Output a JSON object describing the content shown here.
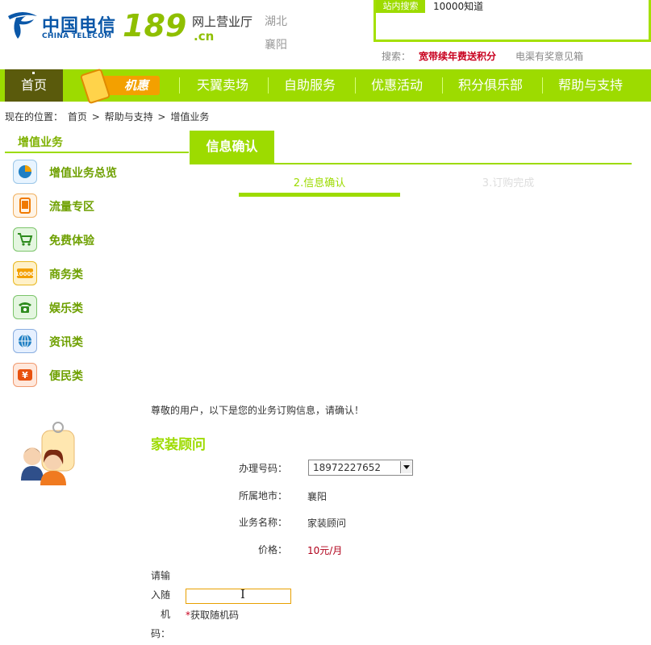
{
  "header": {
    "logo_cn": "中国电信",
    "logo_en": "CHINA TELECOM",
    "brand_number": "189",
    "hall_name": "网上营业厅",
    "domain_suffix": ".cn",
    "province": "湖北",
    "city": "襄阳",
    "search_tab": "站内搜索",
    "search_value": "10000知道",
    "search_label": "搜索：",
    "hot_link_1": "宽带续年费送积分",
    "hot_link_2": "电渠有奖意见箱"
  },
  "nav": {
    "home": "首页",
    "promo": "机惠",
    "items": [
      "天翼卖场",
      "自助服务",
      "优惠活动",
      "积分俱乐部",
      "帮助与支持"
    ]
  },
  "breadcrumb": {
    "prefix": "现在的位置：",
    "items": [
      "首页",
      "帮助与支持",
      "增值业务"
    ],
    "sep": ">"
  },
  "sidebar": {
    "title": "增值业务",
    "items": [
      {
        "label": "增值业务总览",
        "icon": "pie-chart-icon"
      },
      {
        "label": "流量专区",
        "icon": "mobile-phone-icon"
      },
      {
        "label": "免费体验",
        "icon": "cart-icon"
      },
      {
        "label": "商务类",
        "icon": "10000-badge-icon"
      },
      {
        "label": "娱乐类",
        "icon": "telephone-icon"
      },
      {
        "label": "资讯类",
        "icon": "globe-icon"
      },
      {
        "label": "便民类",
        "icon": "yuan-icon"
      }
    ]
  },
  "main": {
    "tab": "信息确认",
    "step_current": "2.信息确认",
    "step_next": "3.订购完成",
    "notice": "尊敬的用户，以下是您的业务订购信息，请确认！",
    "service_title": "家装顾问",
    "form": {
      "phone_label": "办理号码：",
      "phone_value": "18972227652",
      "region_label": "所属地市：",
      "region_value": "襄阳",
      "service_label": "业务名称：",
      "service_value": "家装顾问",
      "price_label": "价格：",
      "price_value": "10元/月",
      "code_label_lines": [
        "请输",
        "入随",
        "机",
        "码："
      ],
      "get_code_star": "*",
      "get_code": "获取随机码"
    }
  },
  "colors": {
    "accent_green": "#9ddb00",
    "dark_olive": "#5a5a0c",
    "promo_orange": "#f3a000",
    "hot_red": "#c8001f",
    "brand_blue": "#0a57a8"
  }
}
